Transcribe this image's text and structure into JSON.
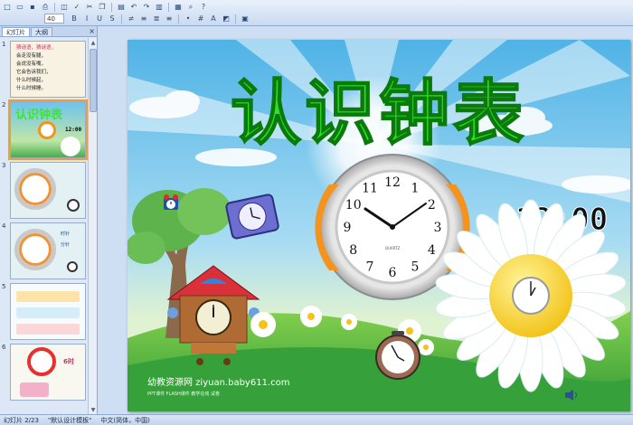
{
  "toolbar": {
    "font_size": "40",
    "row1_icons": [
      "new-icon",
      "open-icon",
      "save-icon",
      "print-icon",
      "print-preview-icon",
      "spell-check-icon",
      "cut-icon",
      "copy-icon",
      "paste-icon",
      "undo-icon",
      "redo-icon",
      "insert-chart-icon",
      "insert-table-icon",
      "zoom-icon",
      "help-icon"
    ],
    "row2_icons": [
      "bold-icon",
      "italic-icon",
      "underline-icon",
      "shadow-icon",
      "strikethrough-icon",
      "align-left-icon",
      "align-center-icon",
      "align-right-icon",
      "bullets-icon",
      "numbering-icon",
      "font-color-icon",
      "design-icon",
      "new-slide-icon"
    ]
  },
  "pane": {
    "tabs": [
      "幻灯片",
      "大纲"
    ],
    "close": "×",
    "slides": [
      {
        "num": "1",
        "lines": [
          "猜谜语，猜谜语，",
          "会走没有腿，",
          "会说没有嘴，",
          "它会告诉我们，",
          "什么时候起，",
          "什么时候睡。"
        ]
      },
      {
        "num": "2",
        "title": "认识钟表",
        "time": "12:00"
      },
      {
        "num": "3"
      },
      {
        "num": "4",
        "labels": [
          "时针",
          "分针"
        ]
      },
      {
        "num": "5"
      },
      {
        "num": "6",
        "caption": "6时"
      }
    ]
  },
  "slide": {
    "title": "认识钟表",
    "digital_time": "12:00",
    "watermark": "幼教资源网 ziyuan.baby611.com",
    "watermark_sub": "PPT课件 FLASH课件 教学在线 试卷",
    "wall_clock_brand": "QUARTZ",
    "clock_numbers": [
      "12",
      "1",
      "2",
      "3",
      "4",
      "5",
      "6",
      "7",
      "8",
      "9",
      "10",
      "11"
    ],
    "colors": {
      "title": "#2fe02a",
      "title_outline": "#0a7a0a",
      "sky_top": "#57b8e8",
      "grass": "#46b34a",
      "accent_orange": "#f5931f"
    }
  },
  "status": {
    "slide_info": "幻灯片 2/23",
    "template": "\"默认设计模板\"",
    "language": "中文(简体，中国)"
  }
}
